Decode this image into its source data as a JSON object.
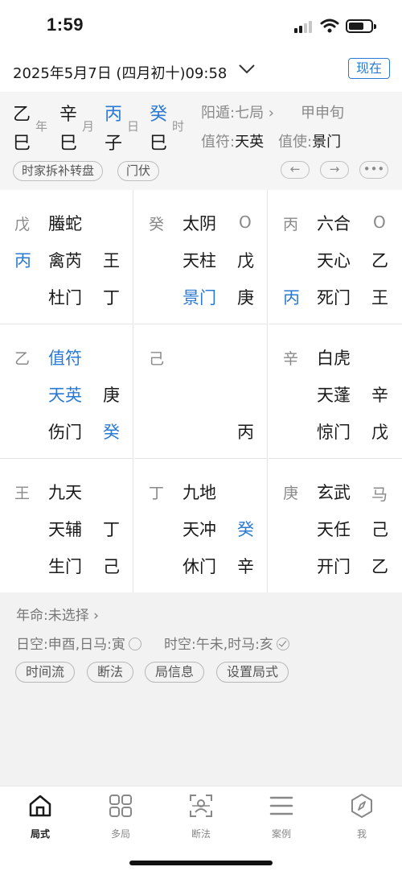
{
  "status": {
    "time": "1:59"
  },
  "header": {
    "date": "2025年5月7日 (四月初十)09:58",
    "now_button": "现在"
  },
  "pillars": [
    {
      "gan": "乙",
      "zhi": "巳",
      "label": "年",
      "gan_color": ""
    },
    {
      "gan": "辛",
      "zhi": "巳",
      "label": "月",
      "gan_color": ""
    },
    {
      "gan": "丙",
      "zhi": "子",
      "label": "日",
      "gan_color": "#2a7ad5"
    },
    {
      "gan": "癸",
      "zhi": "巳",
      "label": "时",
      "gan_color": "#2a7ad5"
    }
  ],
  "meta": {
    "ju": "阳遁:七局",
    "xun": "甲申旬",
    "zhifu_label": "值符:",
    "zhifu_value": "天英",
    "zhishi_label": "值使:",
    "zhishi_value": "景门"
  },
  "pills": [
    "时家拆补转盘",
    "门伏"
  ],
  "nav": {
    "prev": "←",
    "next": "→",
    "more": "•••"
  },
  "palaces": [
    {
      "earth": "戊",
      "god": "螣蛇",
      "tr": "",
      "hs": "丙",
      "star": "禽芮",
      "sstem": "王",
      "door": "杜门",
      "dstem": "丁"
    },
    {
      "earth": "癸",
      "god": "太阴",
      "tr": "O",
      "hs": "",
      "star": "天柱",
      "sstem": "戊",
      "door": "景门",
      "dstem": "庚"
    },
    {
      "earth": "丙",
      "god": "六合",
      "tr": "O",
      "hs": "",
      "star": "天心",
      "sstem": "乙",
      "door": "死门",
      "dstem": "王",
      "door_hs": "丙"
    },
    {
      "earth": "乙",
      "god": "值符",
      "tr": "",
      "hs": "",
      "star": "天英",
      "sstem": "庚",
      "door": "伤门",
      "dstem": "癸"
    },
    {
      "earth": "己",
      "god": "",
      "tr": "",
      "hs": "",
      "star": "",
      "sstem": "",
      "door": "",
      "dstem": "丙"
    },
    {
      "earth": "辛",
      "god": "白虎",
      "tr": "",
      "hs": "",
      "star": "天蓬",
      "sstem": "辛",
      "door": "惊门",
      "dstem": "戊"
    },
    {
      "earth": "王",
      "god": "九天",
      "tr": "",
      "hs": "",
      "star": "天辅",
      "sstem": "丁",
      "door": "生门",
      "dstem": "己"
    },
    {
      "earth": "丁",
      "god": "九地",
      "tr": "",
      "hs": "",
      "star": "天冲",
      "sstem": "癸",
      "door": "休门",
      "dstem": "辛"
    },
    {
      "earth": "庚",
      "god": "玄武",
      "tr": "马",
      "hs": "",
      "star": "天任",
      "sstem": "己",
      "door": "开门",
      "dstem": "乙"
    }
  ],
  "bottom": {
    "nianming": "年命:未选择",
    "rikong": "日空:申酉,日马:寅",
    "shikong": "时空:午未,时马:亥",
    "buttons": [
      "时间流",
      "断法",
      "局信息",
      "设置局式"
    ]
  },
  "tabs": [
    {
      "label": "局式",
      "icon": "home-icon",
      "active": true
    },
    {
      "label": "多局",
      "icon": "grid-icon",
      "active": false
    },
    {
      "label": "断法",
      "icon": "scan-icon",
      "active": false
    },
    {
      "label": "案例",
      "icon": "list-icon",
      "active": false
    },
    {
      "label": "我",
      "icon": "compass-icon",
      "active": false
    }
  ],
  "colors": {
    "accent": "#2a7ad5",
    "muted": "#8a8a8a"
  }
}
